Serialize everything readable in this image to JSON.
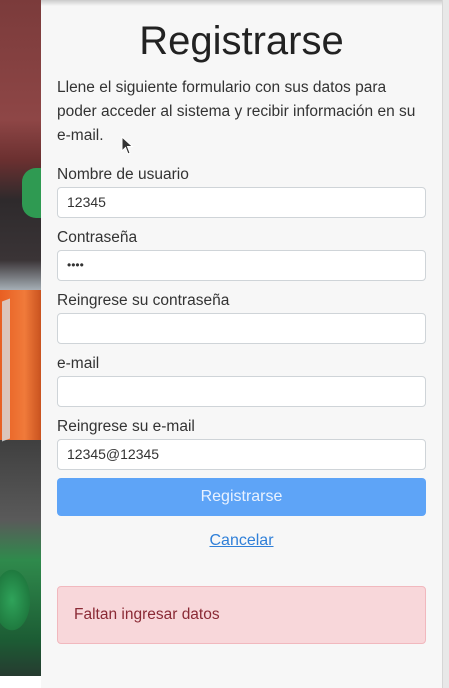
{
  "form": {
    "title": "Registrarse",
    "description": "Llene el siguiente formulario con sus datos para poder acceder al sistema y recibir información en su e-mail.",
    "fields": {
      "username": {
        "label": "Nombre de usuario",
        "value": "12345"
      },
      "password": {
        "label": "Contraseña",
        "value": "••••"
      },
      "password_confirm": {
        "label": "Reingrese su contraseña",
        "value": ""
      },
      "email": {
        "label": "e-mail",
        "value": ""
      },
      "email_confirm": {
        "label": "Reingrese su e-mail",
        "value": "12345@12345"
      }
    },
    "submit_label": "Registrarse",
    "cancel_label": "Cancelar",
    "error_message": "Faltan ingresar datos"
  },
  "colors": {
    "primary": "#5ea4f7",
    "link": "#2f7fd8",
    "alert_bg": "#f8d7da",
    "alert_text": "#8a2a35"
  }
}
